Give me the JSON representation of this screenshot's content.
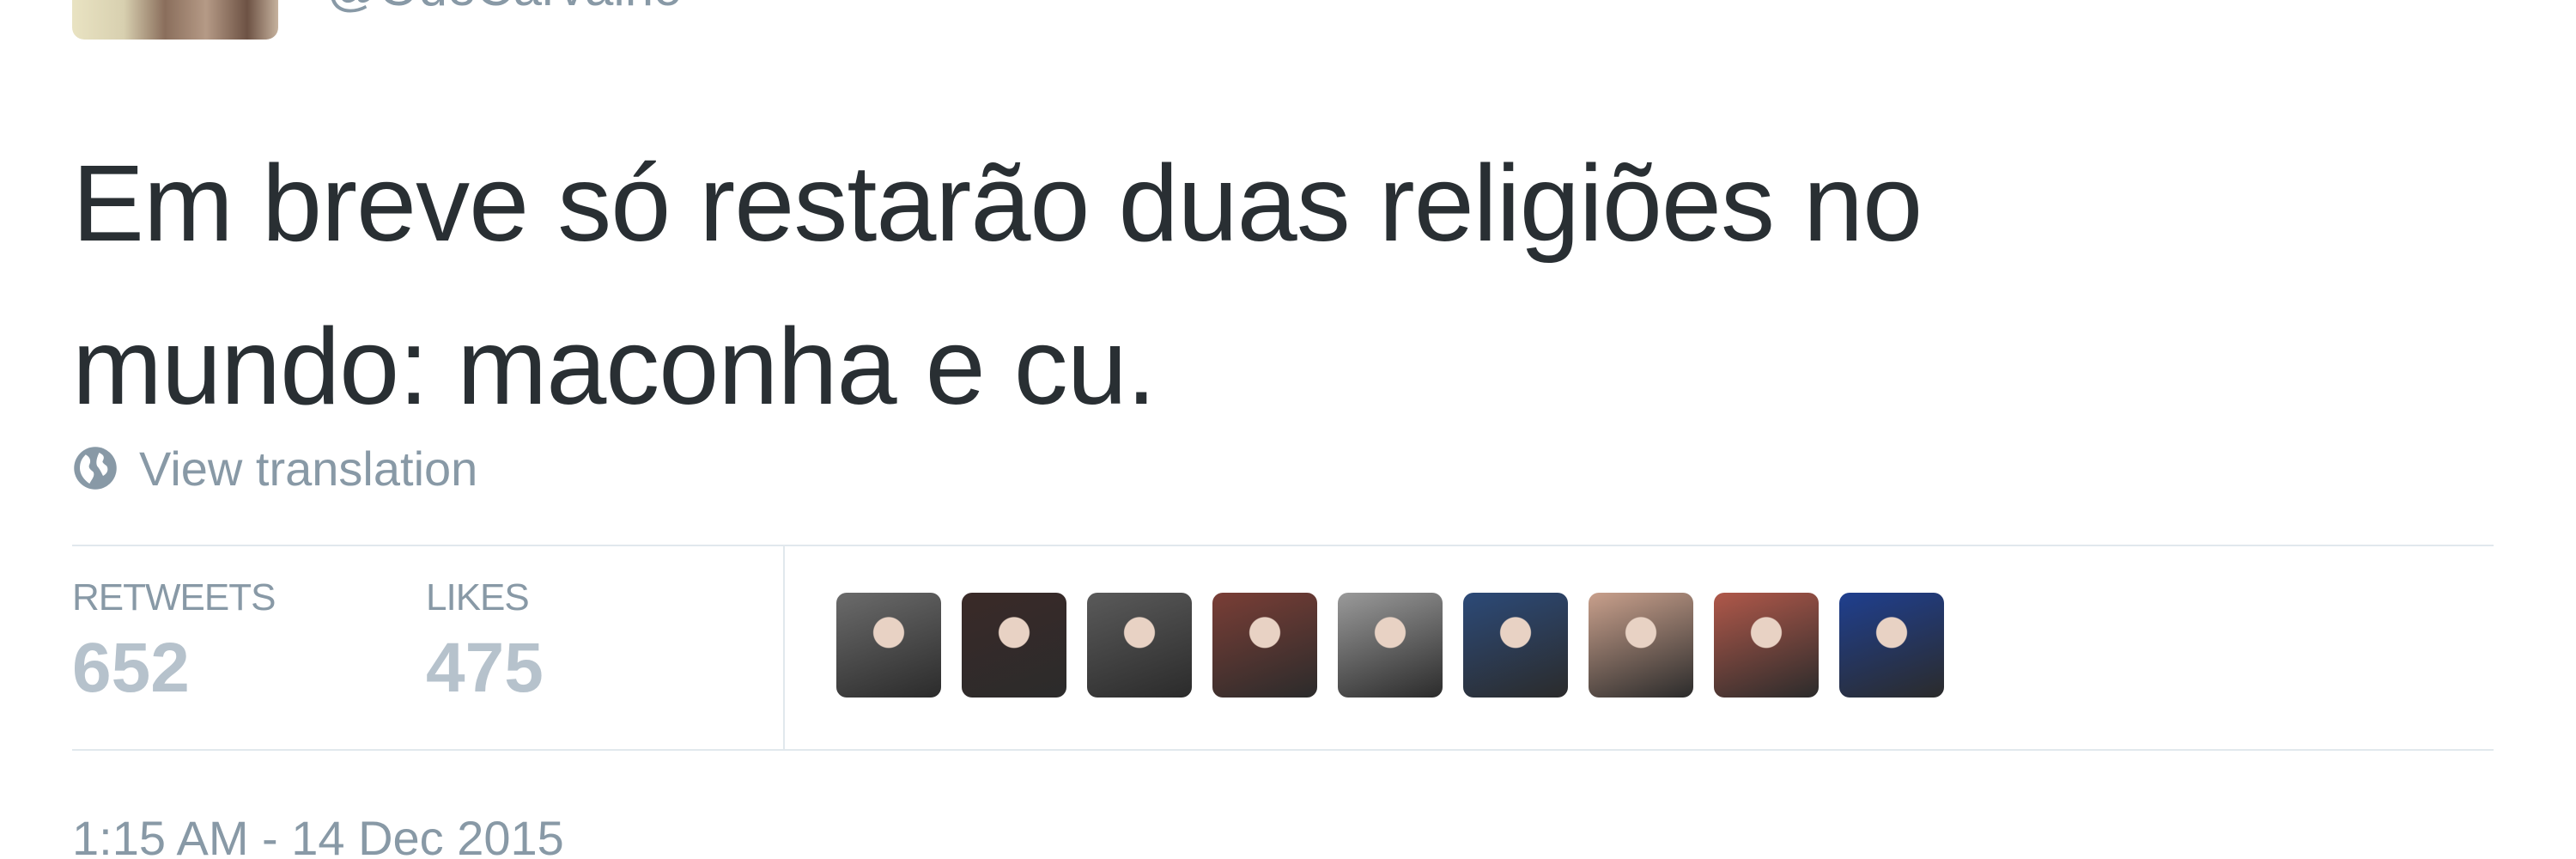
{
  "header": {
    "handle": "@OdeCarvalho"
  },
  "tweet": {
    "text_line1": "Em breve só restarão duas religiões no",
    "text_line2": "mundo: maconha e cu.",
    "view_translation": "View translation",
    "globe_icon": "globe-icon"
  },
  "stats": {
    "retweets_label": "RETWEETS",
    "retweets_value": "652",
    "likes_label": "LIKES",
    "likes_value": "475"
  },
  "likers": [
    {
      "name": "liker-avatar-1",
      "color": "#6b6b6b"
    },
    {
      "name": "liker-avatar-2",
      "color": "#3a2a28"
    },
    {
      "name": "liker-avatar-3",
      "color": "#5a5a5a"
    },
    {
      "name": "liker-avatar-4",
      "color": "#7a3e36"
    },
    {
      "name": "liker-avatar-5",
      "color": "#9a9a9a"
    },
    {
      "name": "liker-avatar-6",
      "color": "#2c4a78"
    },
    {
      "name": "liker-avatar-7",
      "color": "#c9a08c"
    },
    {
      "name": "liker-avatar-8",
      "color": "#b0584a"
    },
    {
      "name": "liker-avatar-9",
      "color": "#1f3f8f"
    }
  ],
  "timestamp": "1:15 AM - 14 Dec 2015",
  "colors": {
    "text": "#292f33",
    "muted": "#8899a6",
    "stat_value": "#b6c2cc",
    "divider": "#e1e8ed"
  }
}
